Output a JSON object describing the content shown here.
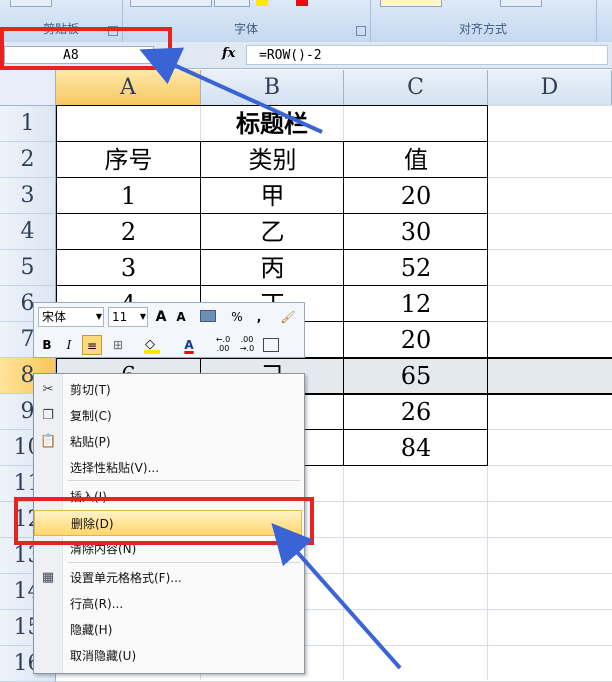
{
  "ribbon": {
    "groups": [
      {
        "label": "剪贴板"
      },
      {
        "label": "字体"
      },
      {
        "label": "对齐方式"
      }
    ]
  },
  "formula_bar": {
    "name_box": "A8",
    "fx_label": "fx",
    "formula": "=ROW()-2"
  },
  "columns": [
    "A",
    "B",
    "C",
    "D"
  ],
  "rows": [
    "1",
    "2",
    "3",
    "4",
    "5",
    "6",
    "7",
    "8",
    "9",
    "10",
    "11",
    "12",
    "13",
    "14",
    "15",
    "16"
  ],
  "table": {
    "title": "标题栏",
    "headers": [
      "序号",
      "类别",
      "值"
    ],
    "data": [
      [
        "1",
        "甲",
        "20"
      ],
      [
        "2",
        "乙",
        "30"
      ],
      [
        "3",
        "丙",
        "52"
      ],
      [
        "4",
        "丁",
        "12"
      ],
      [
        "",
        "",
        "20"
      ],
      [
        "6",
        "己",
        "65"
      ],
      [
        "",
        "",
        "26"
      ],
      [
        "",
        "",
        "84"
      ]
    ]
  },
  "mini_toolbar": {
    "font_name": "宋体",
    "font_size": "11",
    "grow_font": "A",
    "shrink_font": "A",
    "percent": "%",
    "comma": ",",
    "bold": "B",
    "italic": "I",
    "font_color_letter": "A",
    "inc_decimal": ".0\n.00",
    "dec_decimal": ".00\n.0"
  },
  "context_menu": {
    "items": [
      {
        "label": "剪切(T)",
        "icon": "scissors-icon"
      },
      {
        "label": "复制(C)",
        "icon": "copy-icon"
      },
      {
        "label": "粘贴(P)",
        "icon": "paste-icon"
      },
      {
        "label": "选择性粘贴(V)...",
        "icon": ""
      },
      {
        "label": "插入(I)",
        "icon": ""
      },
      {
        "label": "删除(D)",
        "icon": "",
        "highlighted": true
      },
      {
        "label": "清除内容(N)",
        "icon": ""
      },
      {
        "label": "设置单元格格式(F)...",
        "icon": "format-cells-icon"
      },
      {
        "label": "行高(R)...",
        "icon": ""
      },
      {
        "label": "隐藏(H)",
        "icon": ""
      },
      {
        "label": "取消隐藏(U)",
        "icon": ""
      }
    ]
  },
  "colors": {
    "annotation_red": "#e8221f",
    "annotation_arrow": "#3a63d6",
    "menu_highlight": "#ffd66b",
    "row_header_selected": "#f9c65a"
  }
}
